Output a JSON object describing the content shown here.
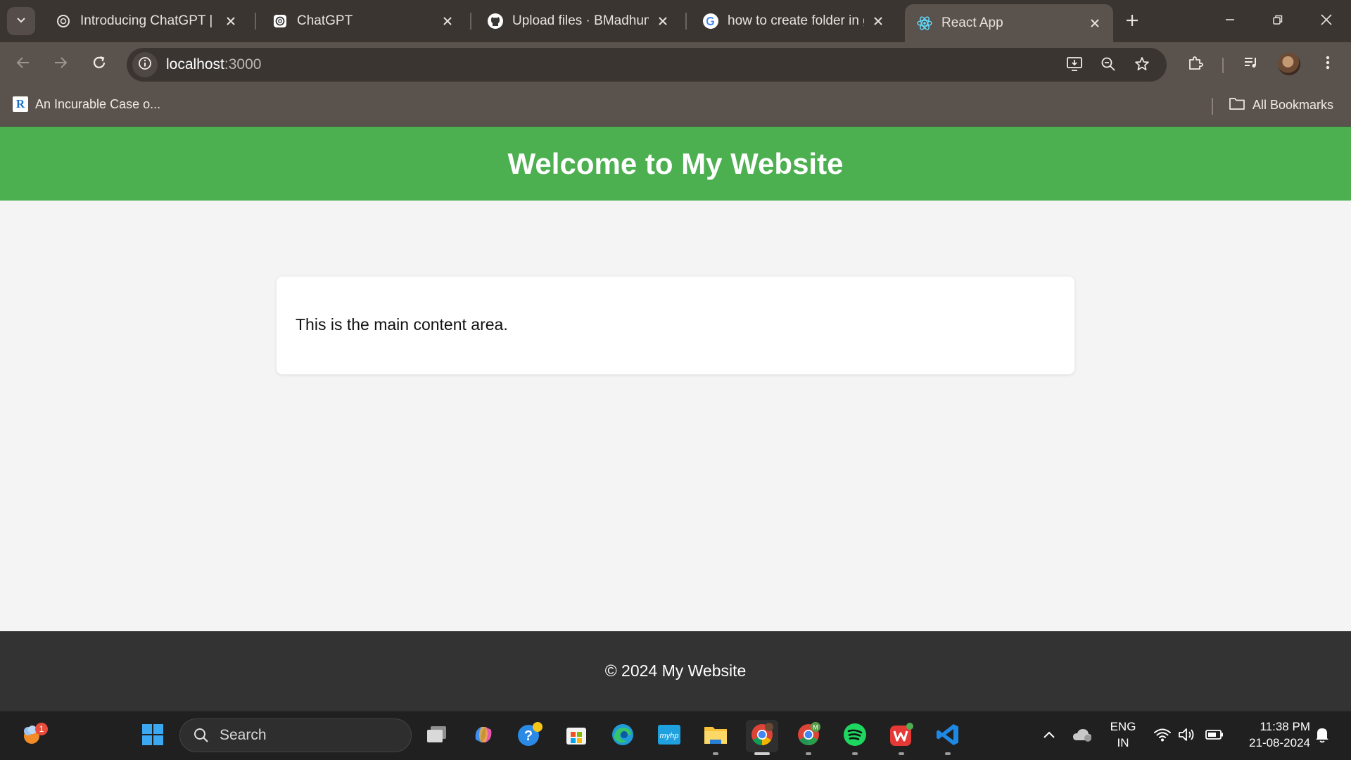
{
  "browser": {
    "tabs": [
      {
        "title": "Introducing ChatGPT | Op",
        "favicon": "openai-icon",
        "active": false
      },
      {
        "title": "ChatGPT",
        "favicon": "openai-icon",
        "active": false
      },
      {
        "title": "Upload files · BMadhumit",
        "favicon": "github-icon",
        "active": false
      },
      {
        "title": "how to create folder in gi",
        "favicon": "google-icon",
        "active": false
      },
      {
        "title": "React App",
        "favicon": "react-icon",
        "active": true
      }
    ],
    "address": {
      "host": "localhost",
      "port": ":3000"
    },
    "bookmarks": {
      "item_label": "An Incurable Case o...",
      "item_favicon_letter": "R",
      "all_label": "All Bookmarks"
    }
  },
  "page": {
    "header_title": "Welcome to My Website",
    "main_text": "This is the main content area.",
    "footer_text": "© 2024 My Website",
    "colors": {
      "header": "#4caf50",
      "footer": "#333333",
      "background": "#f4f4f4"
    }
  },
  "taskbar": {
    "search_label": "Search",
    "notification_badge": "1",
    "language": {
      "line1": "ENG",
      "line2": "IN"
    },
    "clock": {
      "time": "11:38 PM",
      "date": "21-08-2024"
    }
  }
}
